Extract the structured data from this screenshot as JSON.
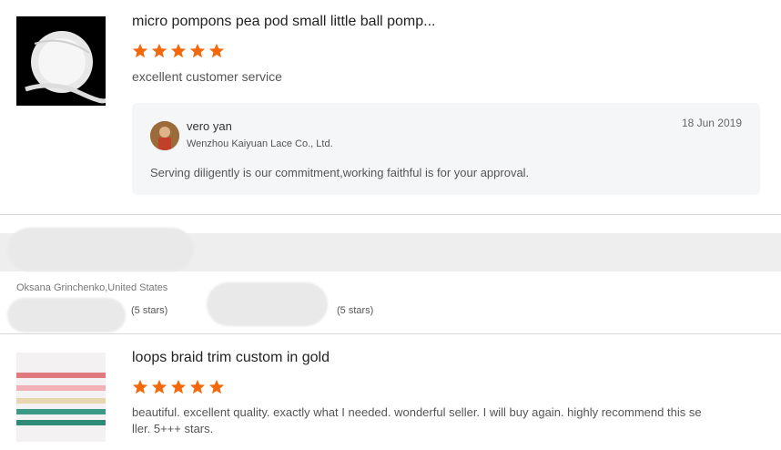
{
  "review1": {
    "title": "micro pompons pea pod small little ball pomp...",
    "stars": 5,
    "comment": "excellent customer service",
    "reply": {
      "name": "vero yan",
      "company": "Wenzhou Kaiyuan Lace Co., Ltd.",
      "date": "18 Jun 2019",
      "text": "Serving diligently is our commitment,working faithful is for your approval."
    }
  },
  "middle": {
    "reviewer": "Oksana Grinchenko,United States",
    "rating_left": "(5 stars)",
    "rating_right": "(5 stars)"
  },
  "review2": {
    "title": "loops braid trim custom in gold",
    "stars": 5,
    "comment_line1": "beautiful. excellent quality. exactly what I needed. wonderful seller. I will buy again. highly recommend this se",
    "comment_line2": "ller. 5+++ stars."
  },
  "colors": {
    "star": "#f4680c",
    "reply_bg": "#f4f6f8"
  }
}
